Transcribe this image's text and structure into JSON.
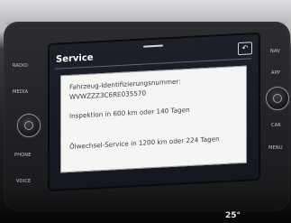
{
  "hardware_buttons": {
    "left": [
      "RADIO",
      "MEDIA",
      "PHONE",
      "VOICE"
    ],
    "right": [
      "NAV",
      "APP",
      "CAR",
      "MENU"
    ]
  },
  "screen": {
    "title": "Service",
    "back_icon": "back-arrow-icon"
  },
  "dialog": {
    "vin_label": "Fahrzeug-Identifizierungsnummer:",
    "vin_value": "WVWZZZ3C6RE035570",
    "inspection": "Inspektion in 600 km oder 140 Tagen",
    "oil_service": "Ölwechsel-Service in 1200 km oder 224 Tagen"
  },
  "bottom_text": "25°"
}
